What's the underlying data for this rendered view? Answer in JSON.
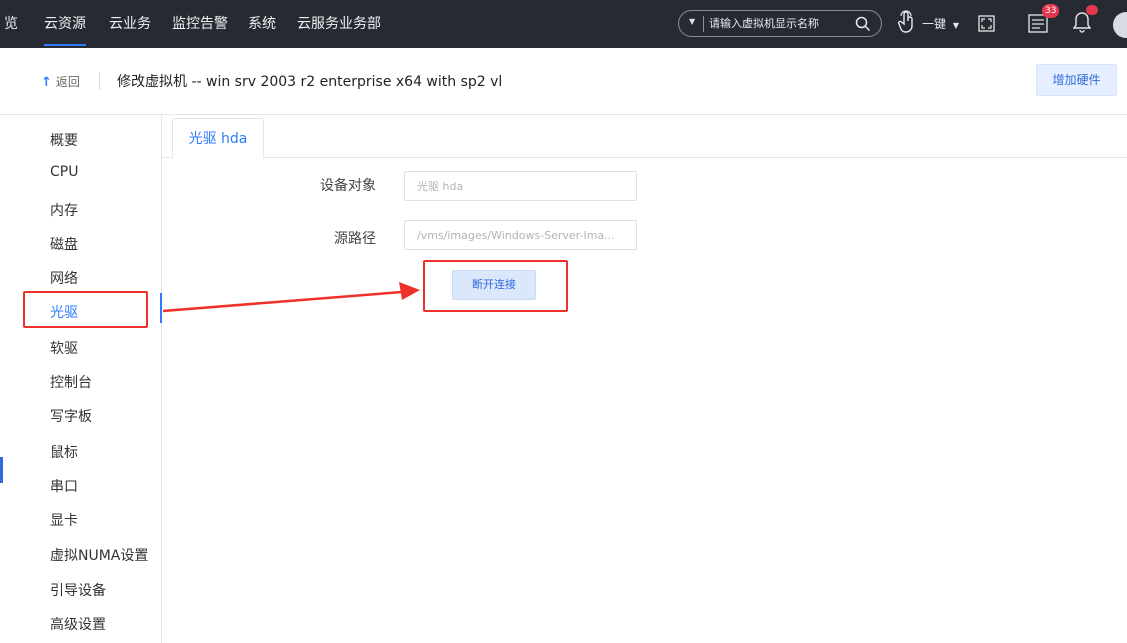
{
  "topnav": {
    "items": [
      {
        "label": "览"
      },
      {
        "label": "云资源"
      },
      {
        "label": "云业务"
      },
      {
        "label": "监控告警"
      },
      {
        "label": "系统"
      },
      {
        "label": "云服务业务部"
      }
    ],
    "search_placeholder": "请输入虚拟机显示名称",
    "onekey_label": "一键",
    "task_badge": "33",
    "alert_badge": "…"
  },
  "header": {
    "back_label": "返回",
    "title": "修改虚拟机 -- win srv 2003 r2 enterprise x64 with sp2 vl",
    "add_hardware_label": "增加硬件"
  },
  "menu": {
    "items": [
      {
        "label": "概要"
      },
      {
        "label": "CPU"
      },
      {
        "label": "内存"
      },
      {
        "label": "磁盘"
      },
      {
        "label": "网络"
      },
      {
        "label": "光驱"
      },
      {
        "label": "软驱"
      },
      {
        "label": "控制台"
      },
      {
        "label": "写字板"
      },
      {
        "label": "鼠标"
      },
      {
        "label": "串口"
      },
      {
        "label": "显卡"
      },
      {
        "label": "虚拟NUMA设置"
      },
      {
        "label": "引导设备"
      },
      {
        "label": "高级设置"
      }
    ],
    "active": "光驱"
  },
  "tabs": [
    {
      "label": "光驱 hda"
    }
  ],
  "form": {
    "device_label": "设备对象",
    "device_value": "光驱 hda",
    "path_label": "源路径",
    "path_value": "/vms/images/Windows-Server-Ima...",
    "disconnect_label": "断开连接"
  },
  "colors": {
    "nav_bg": "#262a33",
    "accent": "#2f7bff",
    "annotation": "#f0302a"
  }
}
